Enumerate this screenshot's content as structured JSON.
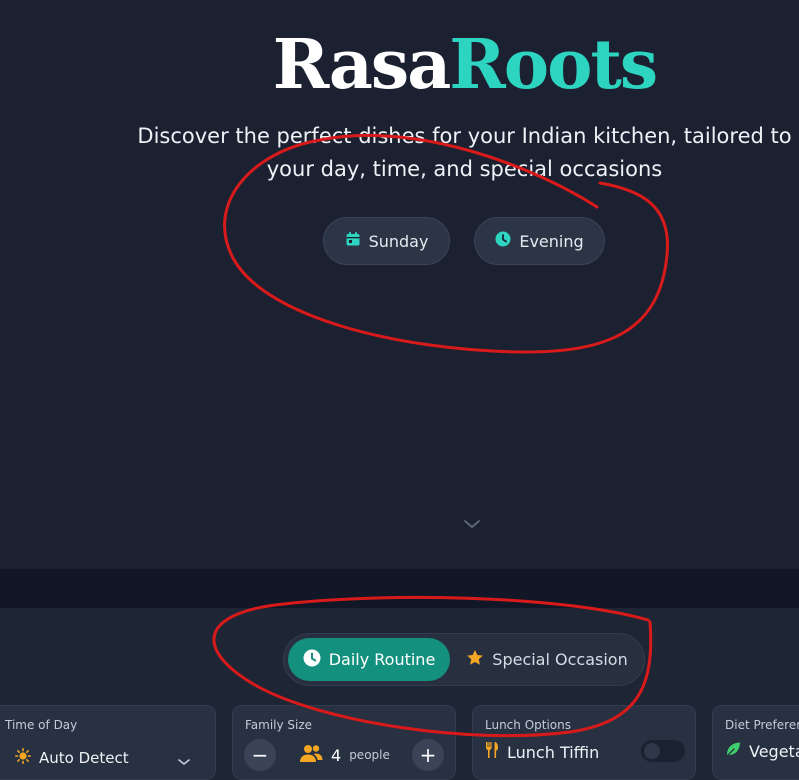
{
  "brand": {
    "part1": "Rasa",
    "part2": "Roots"
  },
  "hero": {
    "tagline_line1": "Discover the perfect dishes for your Indian kitchen, tailored to",
    "tagline_line2": "your day, time, and special occasions",
    "day_label": "Sunday",
    "time_label": "Evening"
  },
  "mode_toggle": {
    "daily_label": "Daily Routine",
    "special_label": "Special Occasion",
    "active": "Daily Routine"
  },
  "cards": {
    "time_of_day": {
      "label": "Time of Day",
      "value": "Auto Detect"
    },
    "family_size": {
      "label": "Family Size",
      "count": "4",
      "unit": "people",
      "minus": "−",
      "plus": "+"
    },
    "lunch_options": {
      "label": "Lunch Options",
      "value": "Lunch Tiffin",
      "enabled": false
    },
    "diet_preference": {
      "label": "Diet Preferenc",
      "value": "Vegeta"
    }
  },
  "colors": {
    "accent": "#2dd4bf",
    "active_segment": "#14917e",
    "background": "#1b2131",
    "annotation": "#d91a1a",
    "star": "#f5a623"
  },
  "icons": {
    "day": "calendar-icon",
    "time": "clock-icon",
    "scroll": "chevron-down-icon",
    "daily": "clock-icon",
    "special": "star-icon",
    "time_of_day": "sun-icon",
    "family": "users-icon",
    "lunch": "utensils-icon",
    "diet": "leaf-icon"
  }
}
